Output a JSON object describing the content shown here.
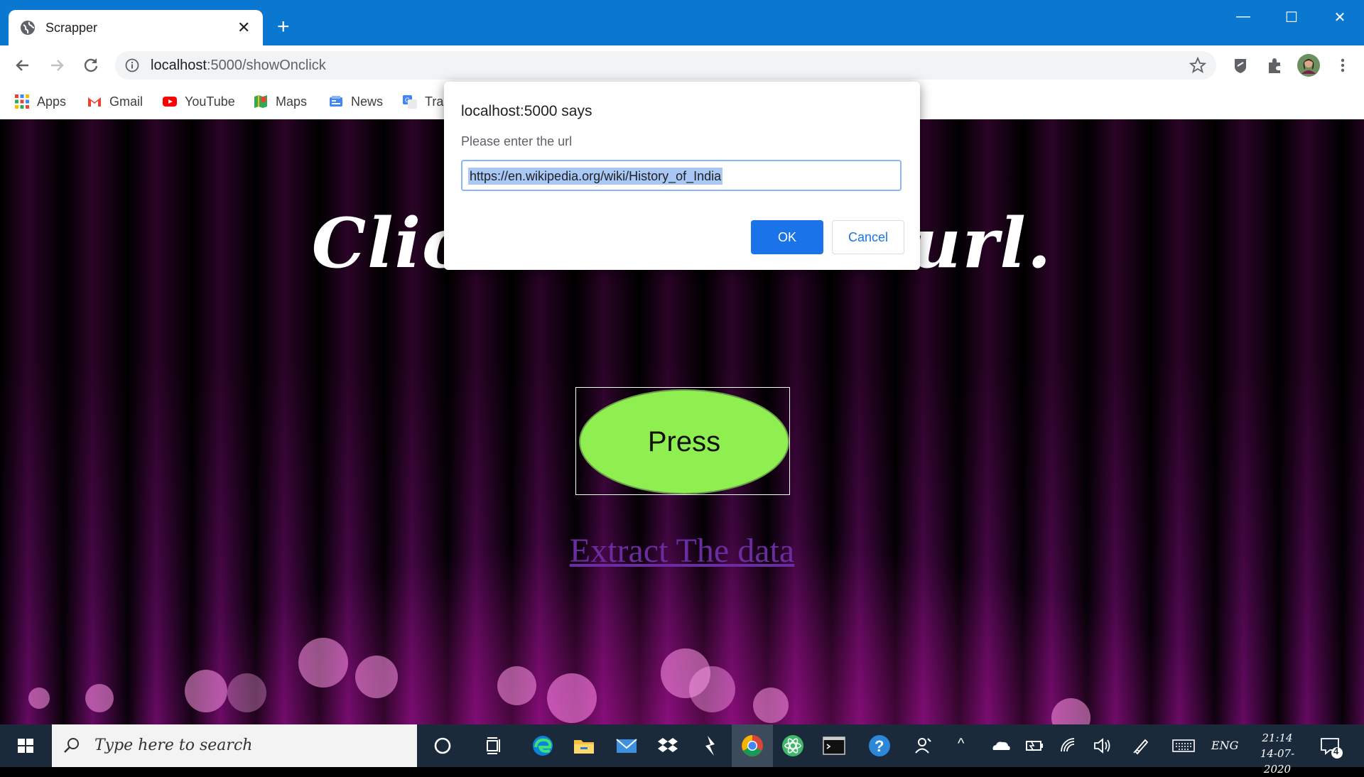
{
  "browser": {
    "tab_title": "Scrapper",
    "url_host": "localhost",
    "url_path": ":5000/showOnclick"
  },
  "bookmarks": [
    {
      "label": "Apps",
      "icon": "apps-grid-icon"
    },
    {
      "label": "Gmail",
      "icon": "gmail-icon"
    },
    {
      "label": "YouTube",
      "icon": "youtube-icon"
    },
    {
      "label": "Maps",
      "icon": "maps-icon"
    },
    {
      "label": "News",
      "icon": "news-icon"
    },
    {
      "label": "Tra",
      "icon": "translate-icon"
    }
  ],
  "page": {
    "headline_left": "Click",
    "headline_right": "url.",
    "press_label": "Press",
    "extract_link": "Extract The data"
  },
  "dialog": {
    "title": "localhost:5000 says",
    "message": "Please enter the url",
    "input_value": "https://en.wikipedia.org/wiki/History_of_India",
    "ok_label": "OK",
    "cancel_label": "Cancel"
  },
  "taskbar": {
    "search_placeholder": "Type here to search",
    "language": "ENG",
    "time": "21:14",
    "date": "14-07-2020",
    "notification_count": "4"
  },
  "colors": {
    "chrome_blue": "#0a78d1",
    "ok_blue": "#1a73e8",
    "press_green": "#8fee50",
    "link_purple": "#6a2ca0"
  }
}
